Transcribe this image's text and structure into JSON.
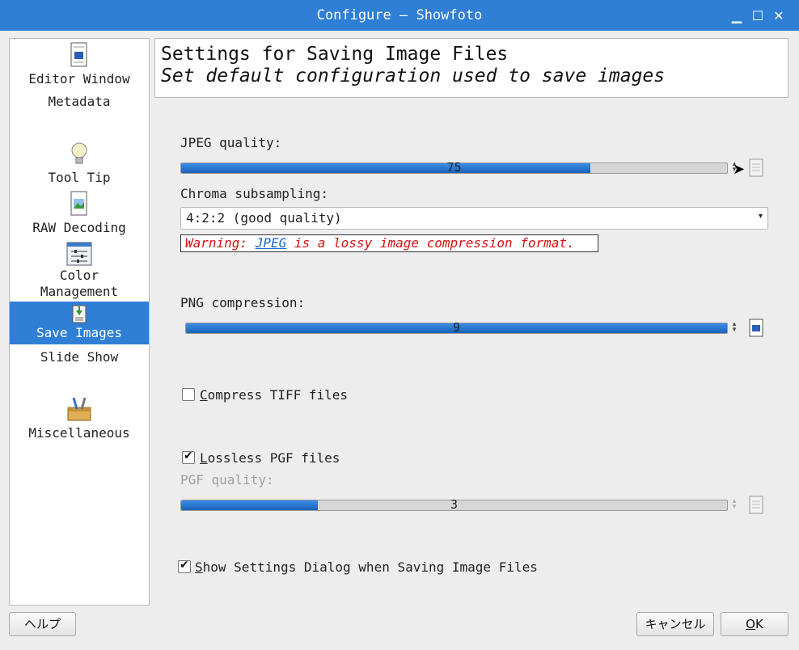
{
  "window": {
    "title": "Configure — Showfoto"
  },
  "sidebar": {
    "items": [
      {
        "label": "Editor Window"
      },
      {
        "label": "Metadata"
      },
      {
        "label": "Tool Tip"
      },
      {
        "label": "RAW Decoding"
      },
      {
        "label": "Color"
      },
      {
        "label": "Management"
      },
      {
        "label": "Save Images"
      },
      {
        "label": "Slide Show"
      },
      {
        "label": "Miscellaneous"
      }
    ]
  },
  "header": {
    "title": "Settings for Saving Image Files",
    "subtitle": "Set default configuration used to save images"
  },
  "jpeg": {
    "label": "JPEG quality:",
    "value": "75",
    "fraction": 0.75,
    "chroma_label": "Chroma subsampling:",
    "chroma_value": "4:2:2 (good quality)",
    "warning_prefix": "Warning: ",
    "warning_link": "JPEG",
    "warning_suffix": " is a lossy image compression format."
  },
  "png": {
    "label": "PNG compression:",
    "value": "9",
    "fraction": 1.0
  },
  "tiff": {
    "label_key": "C",
    "label_rest": "ompress TIFF files",
    "checked": false
  },
  "pgf": {
    "lossless_key": "L",
    "lossless_rest": "ossless PGF files",
    "lossless_checked": true,
    "quality_label": "PGF quality:",
    "value": "3",
    "fraction": 0.25
  },
  "show_dialog": {
    "key": "S",
    "rest": "how Settings Dialog when Saving Image Files",
    "checked": true
  },
  "buttons": {
    "help": "ヘルプ",
    "cancel": "キャンセル",
    "ok_key": "O",
    "ok_rest": "K"
  },
  "colors": {
    "accent": "#2f7fd6",
    "warning": "#d81010"
  }
}
